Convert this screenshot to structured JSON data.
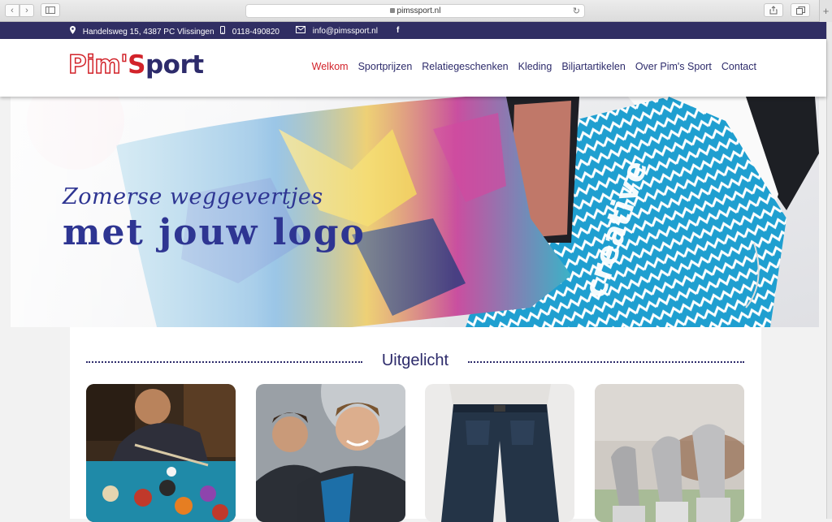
{
  "browser": {
    "url": "pimssport.nl",
    "back_icon": "chevron-left",
    "forward_icon": "chevron-right",
    "sidebar_icon": "sidebar",
    "reload_icon": "reload",
    "share_icon": "share",
    "tabs_icon": "tabs",
    "new_tab_icon": "plus"
  },
  "infobar": {
    "address": "Handelsweg 15, 4387 PC Vlissingen",
    "phone": "0118-490820",
    "email": "info@pimssport.nl",
    "address_icon": "map-pin",
    "phone_icon": "mobile-phone",
    "email_icon": "envelope",
    "social_icon": "facebook",
    "social_label": "f"
  },
  "logo": {
    "part1": "Pim'",
    "part2": "S",
    "part3": "port"
  },
  "nav": {
    "items": [
      {
        "label": "Welkom",
        "active": true
      },
      {
        "label": "Sportprijzen",
        "active": false
      },
      {
        "label": "Relatiegeschenken",
        "active": false
      },
      {
        "label": "Kleding",
        "active": false
      },
      {
        "label": "Biljartartikelen",
        "active": false
      },
      {
        "label": "Over Pim's Sport",
        "active": false
      },
      {
        "label": "Contact",
        "active": false
      }
    ]
  },
  "hero": {
    "line1": "Zomerse weggevertjes",
    "line2": "met jouw logo",
    "pouch_text": "creative"
  },
  "featured": {
    "title": "Uitgelicht",
    "cards": [
      {
        "subject": "billiards"
      },
      {
        "subject": "sportswear"
      },
      {
        "subject": "workwear-jeans"
      },
      {
        "subject": "horse-trophies"
      }
    ]
  },
  "colors": {
    "brand_navy": "#2d2b6b",
    "brand_red": "#d2232a",
    "infobar_bg": "#302e63",
    "hero_text": "#2e3592"
  }
}
